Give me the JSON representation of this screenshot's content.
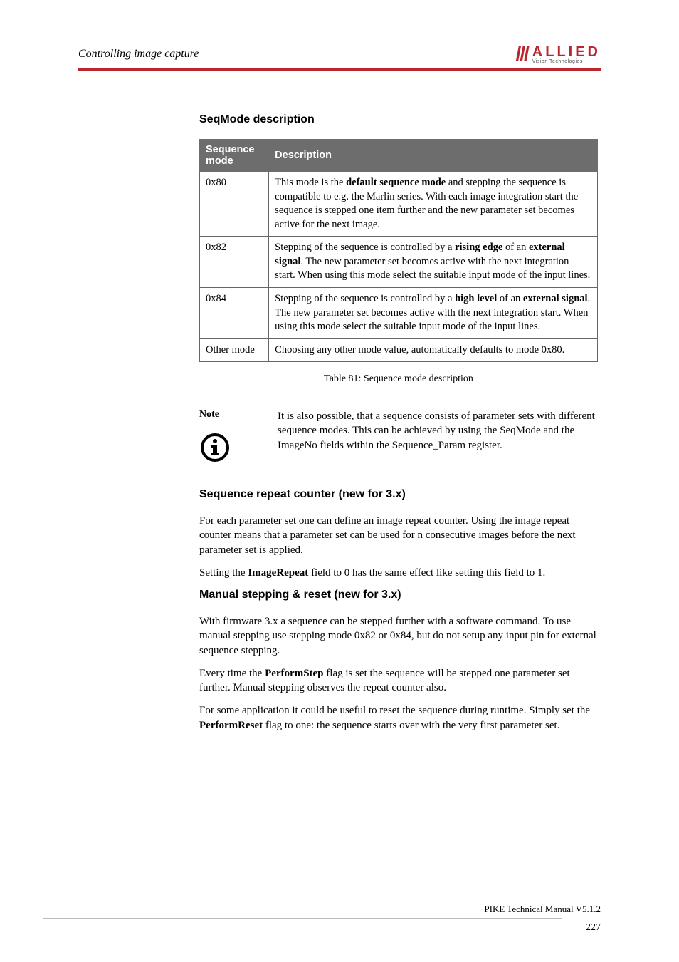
{
  "header": {
    "chapter": "Controlling image capture",
    "logo_main": "ALLIED",
    "logo_sub": "Vision Technologies"
  },
  "sections": {
    "seqmode_title": "SeqMode description",
    "repeat_title": "Sequence repeat counter (new for 3.x)",
    "manual_title": "Manual stepping & reset (new for 3.x)"
  },
  "table": {
    "col1": "Sequence mode",
    "col2": "Description",
    "rows": [
      {
        "mode": "0x80",
        "pre": "This mode is the ",
        "bold": "default sequence mode",
        "post": " and stepping the sequence is compatible to e.g. the Marlin series. With each image integration start the sequence is stepped one item further and the new parameter set becomes active for the next image."
      },
      {
        "mode": "0x82",
        "pre": "Stepping of the sequence is controlled by a ",
        "bold": "rising edge",
        "mid": " of an ",
        "bold2": "external signal",
        "post": ". The new parameter set becomes active with the next integration start. When using this mode select the suitable input mode of the input lines."
      },
      {
        "mode": "0x84",
        "pre": "Stepping of the sequence is controlled by a ",
        "bold": "high level",
        "mid": " of an ",
        "bold2": "external signal",
        "post": ". The new parameter set becomes active with the next integration start. When using this mode select the suitable input mode of the input lines."
      },
      {
        "mode": "Other mode",
        "plain": "Choosing any other mode value, automatically defaults to mode 0x80."
      }
    ],
    "caption": "Table 81: Sequence mode description"
  },
  "note": {
    "label": "Note",
    "body": "It is also possible, that a sequence consists of parameter sets with different sequence modes. This can be achieved by using the SeqMode and the ImageNo fields within the Sequence_Param register."
  },
  "repeat": {
    "p1": "For each parameter set one can define an image repeat counter. Using the image repeat counter means that a parameter set can be used for n consecutive images before the next parameter set is applied.",
    "p2_pre": "Setting the ",
    "p2_bold": "ImageRepeat",
    "p2_post": " field to 0 has the same effect like setting this field to 1."
  },
  "manual": {
    "p1": "With firmware 3.x a sequence can be stepped further with a software command. To use manual stepping use stepping mode 0x82 or 0x84, but do not setup any input pin for external sequence stepping.",
    "p2_pre": "Every time the ",
    "p2_bold": "PerformStep",
    "p2_post": " flag is set the sequence will be stepped one parameter set further. Manual stepping observes the repeat counter also.",
    "p3_pre": "For some application it could be useful to reset the sequence during runtime. Simply set the ",
    "p3_bold": "PerformReset",
    "p3_post": " flag to one: the sequence starts over with the very first parameter set."
  },
  "footer": {
    "doc": "PIKE Technical Manual V5.1.2",
    "page": "227"
  }
}
